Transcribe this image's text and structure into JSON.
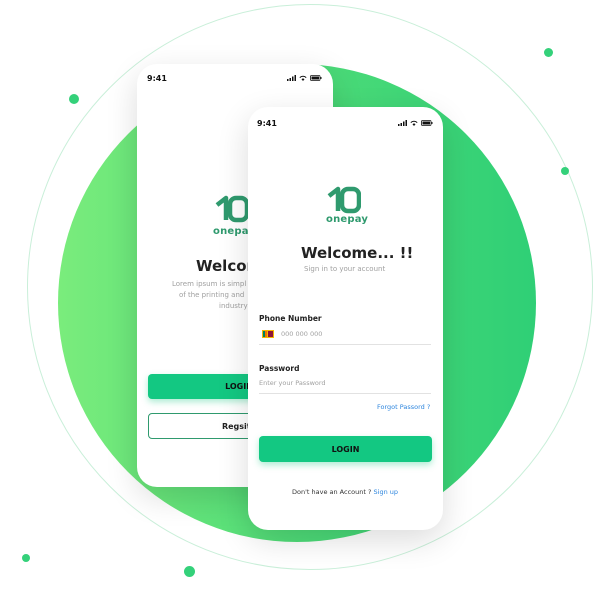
{
  "colors": {
    "accent": "#13c882",
    "brand": "#2f9a6e",
    "link": "#2e86de",
    "background_disc": "#4fdc78"
  },
  "back_screen": {
    "time": "9:41",
    "brand_name": "onepay",
    "heading": "Welcome",
    "description_lines": [
      "Lorem ipsum is simpl",
      "of the printing and",
      "industry"
    ],
    "login_label": "LOGIN",
    "register_label": "Regsite"
  },
  "front_screen": {
    "time": "9:41",
    "brand_name": "onepay",
    "heading": "Welcome... !!",
    "subheading": "Sign in to your account",
    "phone_label": "Phone Number",
    "phone_placeholder": "000 000 000",
    "country_flag": "sri-lanka-flag-icon",
    "password_label": "Password",
    "password_placeholder": "Enter your Password",
    "forgot_label": "Forgot Passord ?",
    "login_label": "LOGIN",
    "signup_prompt": "Don't have an Account ?",
    "signup_link": "Sign up"
  }
}
